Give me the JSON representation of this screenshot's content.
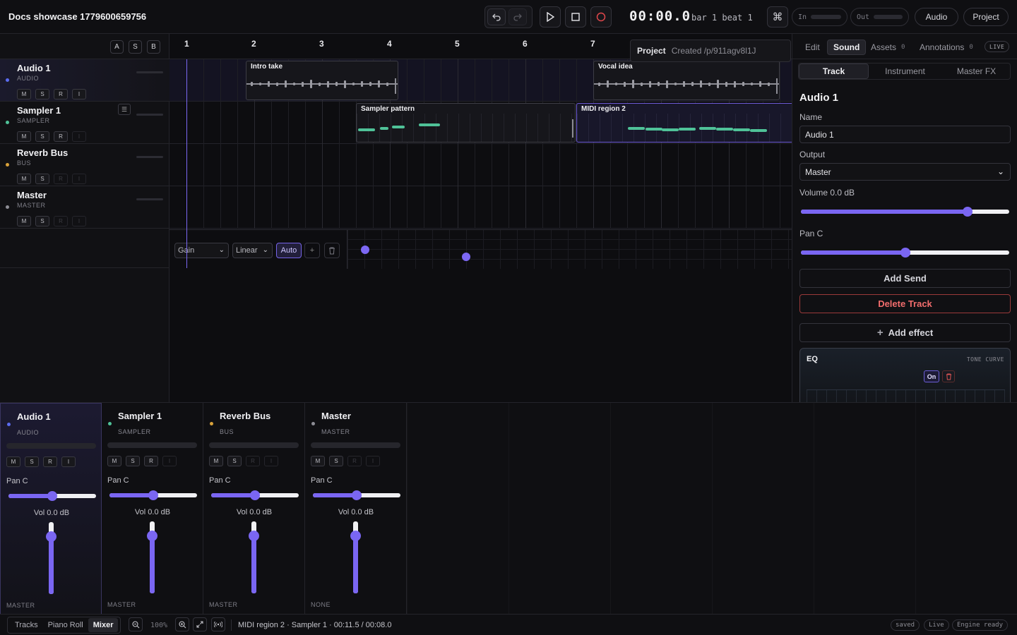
{
  "app": {
    "title": "Docs showcase 1779600659756"
  },
  "transport": {
    "time": "00:00.0",
    "bar_beat": "bar 1 beat 1",
    "in_label": "In",
    "out_label": "Out",
    "audio_label": "Audio",
    "project_label": "Project"
  },
  "timeline": {
    "ab_buttons": [
      "A",
      "S",
      "B"
    ],
    "bars": [
      "1",
      "2",
      "3",
      "4",
      "5",
      "6",
      "7"
    ],
    "tracks": [
      {
        "name": "Audio 1",
        "type": "AUDIO",
        "color": "#5b6cf0",
        "buttons": [
          "M",
          "S",
          "R",
          "I"
        ]
      },
      {
        "name": "Sampler 1",
        "type": "SAMPLER",
        "color": "#4fc298",
        "buttons": [
          "M",
          "S",
          "R",
          "I"
        ]
      },
      {
        "name": "Reverb Bus",
        "type": "BUS",
        "color": "#d9a23a",
        "buttons": [
          "M",
          "S",
          "R",
          "I"
        ]
      },
      {
        "name": "Master",
        "type": "MASTER",
        "color": "#8d8d95",
        "buttons": [
          "M",
          "S",
          "R",
          "I"
        ]
      }
    ],
    "regions": [
      {
        "name": "Intro take",
        "track": 0
      },
      {
        "name": "Vocal idea",
        "track": 0
      },
      {
        "name": "Sampler pattern",
        "track": 1
      },
      {
        "name": "MIDI region 2",
        "track": 1
      }
    ],
    "project_popup": {
      "label": "Project",
      "text": "Created /p/911agv8l1J"
    },
    "automation": {
      "param": "Gain",
      "curve": "Linear",
      "auto_label": "Auto",
      "add_label": "+"
    }
  },
  "inspector": {
    "tabs": [
      {
        "label": "Edit"
      },
      {
        "label": "Sound"
      },
      {
        "label": "Assets",
        "count": "0"
      },
      {
        "label": "Annotations",
        "count": "0"
      }
    ],
    "live_badge": "LIVE",
    "subtabs": [
      "Track",
      "Instrument",
      "Master FX"
    ],
    "track_title": "Audio 1",
    "name_label": "Name",
    "name_value": "Audio 1",
    "output_label": "Output",
    "output_value": "Master",
    "volume_label": "Volume 0.0 dB",
    "volume_level": 0.8,
    "pan_label": "Pan C",
    "pan_level": 0.5,
    "add_send": "Add Send",
    "delete_track": "Delete Track",
    "add_effect": "Add effect",
    "eq": {
      "title": "EQ",
      "subtitle": "TONE CURVE",
      "on_label": "On"
    }
  },
  "mixer": {
    "strips": [
      {
        "name": "Audio 1",
        "type": "AUDIO",
        "color": "#5b6cf0",
        "pan": "Pan C",
        "vol": "Vol 0.0 dB",
        "out": "MASTER"
      },
      {
        "name": "Sampler 1",
        "type": "SAMPLER",
        "color": "#4fc298",
        "pan": "Pan C",
        "vol": "Vol 0.0 dB",
        "out": "MASTER"
      },
      {
        "name": "Reverb Bus",
        "type": "BUS",
        "color": "#d9a23a",
        "pan": "Pan C",
        "vol": "Vol 0.0 dB",
        "out": "MASTER"
      },
      {
        "name": "Master",
        "type": "MASTER",
        "color": "#8d8d95",
        "pan": "Pan C",
        "vol": "Vol 0.0 dB",
        "out": "NONE"
      }
    ]
  },
  "statusbar": {
    "views": [
      "Tracks",
      "Piano Roll",
      "Mixer"
    ],
    "zoom": "100%",
    "info": "MIDI region 2 · Sampler 1 · 00:11.5 / 00:08.0",
    "tags": [
      "saved",
      "Live",
      "Engine ready"
    ]
  },
  "colors": {
    "accent": "#7a66f2",
    "danger": "#f26d6d",
    "midi_note": "#4fc298"
  }
}
